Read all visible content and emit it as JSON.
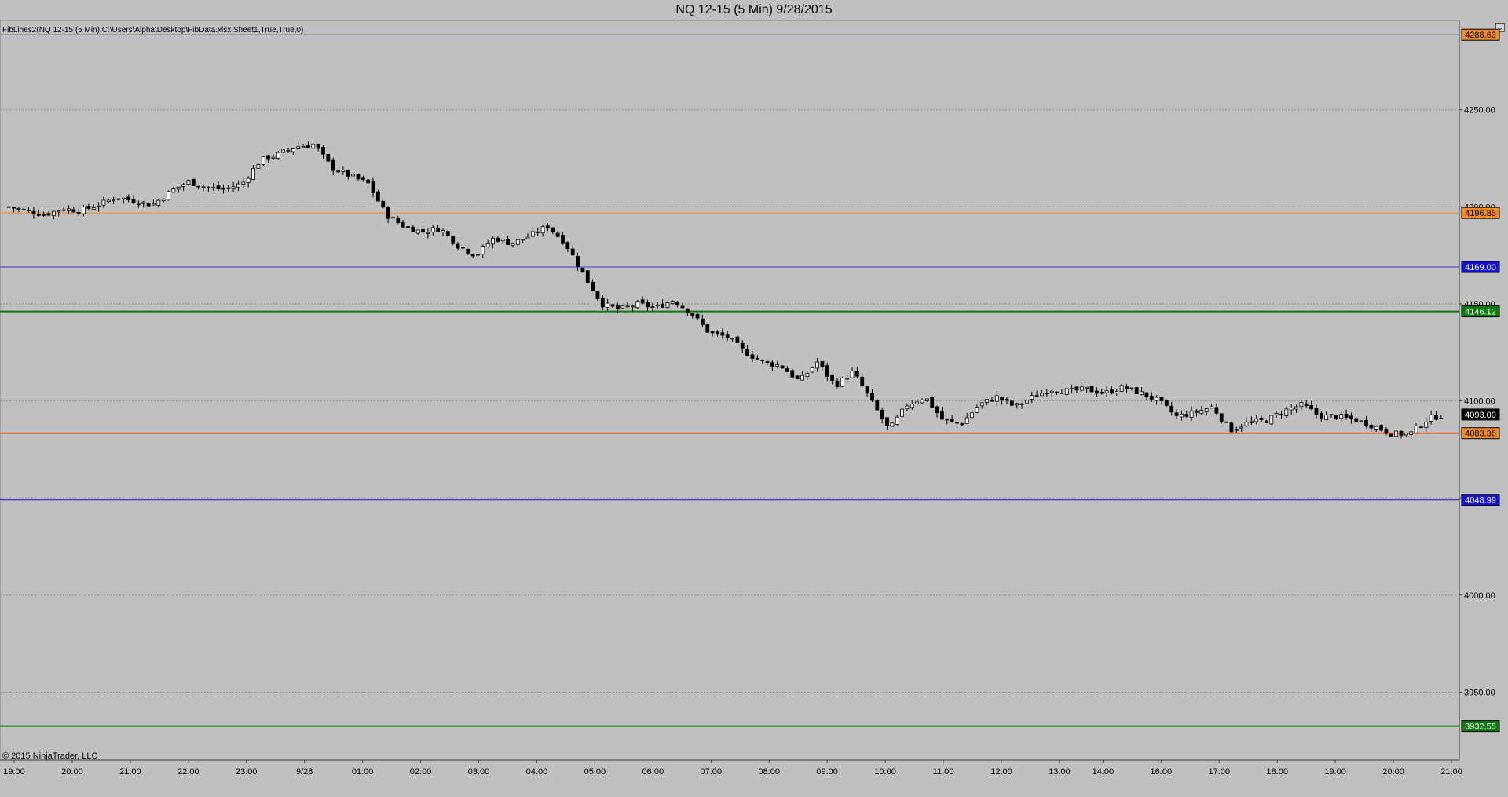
{
  "window": {
    "title": "NQ 12-15 (5 Min)  9/28/2015",
    "indicator_label": "FibLines2(NQ 12-15 (5 Min),C:\\Users\\Alpha\\Desktop\\FibData.xlsx,Sheet1,True,True,0)",
    "copyright": "© 2015 NinjaTrader, LLC",
    "corner_button": "⌄"
  },
  "chart_data": {
    "type": "candlestick",
    "instrument": "NQ 12-15",
    "interval": "5 Min",
    "ylim": [
      3915,
      4296
    ],
    "y_ticks": [
      3950,
      4000,
      4050,
      4100,
      4150,
      4200,
      4250
    ],
    "y_tick_labels": [
      "3950.00",
      "4000.00",
      "4050.00",
      "4100.00",
      "4150.00",
      "4200.00",
      "4250.00"
    ],
    "x_tick_labels": [
      "19:00",
      "20:00",
      "21:00",
      "22:00",
      "23:00",
      "9/28",
      "01:00",
      "02:00",
      "03:00",
      "04:00",
      "05:00",
      "06:00",
      "07:00",
      "08:00",
      "09:00",
      "10:00",
      "11:00",
      "12:00",
      "13:00",
      "14:00",
      "16:00",
      "17:00",
      "18:00",
      "19:00",
      "20:00",
      "21:00"
    ],
    "grid": true,
    "levels": [
      {
        "value": 4288.63,
        "label": "4288.63",
        "color": "#2a2aa8",
        "badge": "#f28c28",
        "thick": false
      },
      {
        "value": 4196.85,
        "label": "4196.85",
        "color": "#f28c28",
        "badge": "#f28c28",
        "thick": false
      },
      {
        "value": 4169.0,
        "label": "4169.00",
        "color": "#3a3ae0",
        "badge": "#1414d2",
        "thick": false
      },
      {
        "value": 4146.12,
        "label": "4146.12",
        "color": "#0a7a0a",
        "badge": "#0a7a0a",
        "thick": true
      },
      {
        "value": 4083.36,
        "label": "4083.36",
        "color": "#f0641e",
        "badge": "#f28c28",
        "thick": true
      },
      {
        "value": 4048.99,
        "label": "4048.99",
        "color": "#1414b4",
        "badge": "#1414d2",
        "thick": false
      },
      {
        "value": 3932.55,
        "label": "3932.55",
        "color": "#0a7a0a",
        "badge": "#0a7a0a",
        "thick": true
      }
    ],
    "last_price": {
      "value": 4093.0,
      "label": "4093.00"
    },
    "close_anchors": [
      [
        0,
        4200
      ],
      [
        15,
        4198
      ],
      [
        30,
        4196
      ],
      [
        45,
        4199
      ],
      [
        60,
        4198
      ],
      [
        75,
        4201
      ],
      [
        90,
        4205
      ],
      [
        105,
        4203
      ],
      [
        120,
        4201
      ],
      [
        135,
        4208
      ],
      [
        150,
        4213
      ],
      [
        165,
        4210
      ],
      [
        180,
        4209
      ],
      [
        195,
        4212
      ],
      [
        210,
        4224
      ],
      [
        225,
        4227
      ],
      [
        240,
        4231
      ],
      [
        255,
        4232
      ],
      [
        270,
        4220
      ],
      [
        285,
        4216
      ],
      [
        300,
        4212
      ],
      [
        315,
        4196
      ],
      [
        330,
        4190
      ],
      [
        345,
        4187
      ],
      [
        360,
        4189
      ],
      [
        375,
        4180
      ],
      [
        390,
        4175
      ],
      [
        405,
        4184
      ],
      [
        420,
        4181
      ],
      [
        435,
        4185
      ],
      [
        450,
        4190
      ],
      [
        465,
        4181
      ],
      [
        480,
        4165
      ],
      [
        495,
        4150
      ],
      [
        510,
        4147
      ],
      [
        525,
        4150
      ],
      [
        540,
        4148
      ],
      [
        555,
        4152
      ],
      [
        570,
        4145
      ],
      [
        585,
        4135
      ],
      [
        600,
        4133
      ],
      [
        615,
        4125
      ],
      [
        630,
        4120
      ],
      [
        645,
        4118
      ],
      [
        660,
        4110
      ],
      [
        675,
        4120
      ],
      [
        690,
        4108
      ],
      [
        705,
        4115
      ],
      [
        720,
        4100
      ],
      [
        735,
        4085
      ],
      [
        750,
        4098
      ],
      [
        765,
        4102
      ],
      [
        780,
        4090
      ],
      [
        795,
        4088
      ],
      [
        810,
        4098
      ],
      [
        825,
        4102
      ],
      [
        840,
        4097
      ],
      [
        855,
        4102
      ],
      [
        870,
        4106
      ],
      [
        885,
        4105
      ],
      [
        900,
        4106
      ],
      [
        915,
        4104
      ],
      [
        930,
        4107
      ],
      [
        945,
        4104
      ],
      [
        960,
        4100
      ],
      [
        975,
        4092
      ],
      [
        990,
        4094
      ],
      [
        1005,
        4097
      ],
      [
        1020,
        4085
      ],
      [
        1035,
        4089
      ],
      [
        1050,
        4090
      ],
      [
        1065,
        4095
      ],
      [
        1080,
        4098
      ],
      [
        1095,
        4092
      ],
      [
        1110,
        4092
      ],
      [
        1125,
        4090
      ],
      [
        1140,
        4087
      ],
      [
        1155,
        4083
      ],
      [
        1170,
        4083
      ],
      [
        1185,
        4091
      ],
      [
        1200,
        4093
      ]
    ],
    "span": 1200,
    "x_tick_positions": [
      0,
      60,
      120,
      180,
      240,
      300,
      360,
      420,
      480,
      540,
      600,
      660,
      720,
      780,
      840,
      900,
      960,
      1020,
      1080,
      1125,
      1185,
      1245,
      1305,
      1365,
      1425,
      1485
    ]
  }
}
